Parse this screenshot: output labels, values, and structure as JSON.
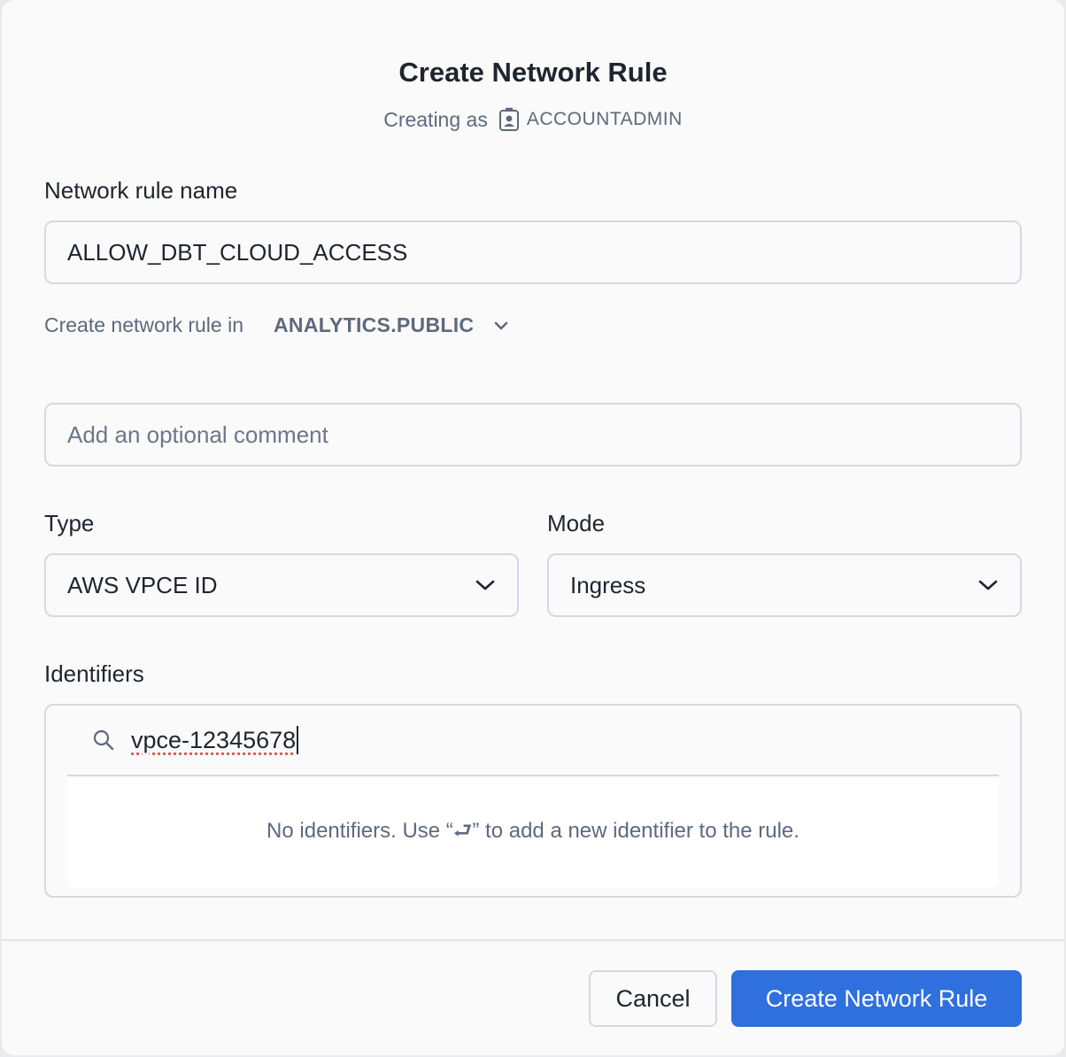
{
  "dialog": {
    "title": "Create Network Rule",
    "creating_as_label": "Creating as",
    "role": "ACCOUNTADMIN"
  },
  "name_field": {
    "label": "Network rule name",
    "value": "ALLOW_DBT_CLOUD_ACCESS"
  },
  "location": {
    "label": "Create network rule in",
    "schema": "ANALYTICS.PUBLIC"
  },
  "comment_field": {
    "placeholder": "Add an optional comment"
  },
  "type_field": {
    "label": "Type",
    "value": "AWS VPCE ID"
  },
  "mode_field": {
    "label": "Mode",
    "value": "Ingress"
  },
  "identifiers": {
    "label": "Identifiers",
    "input_value": "vpce-12345678",
    "empty_message": "No identifiers. Use “⮐” to add a new identifier to the rule."
  },
  "footer": {
    "cancel_label": "Cancel",
    "submit_label": "Create Network Rule"
  },
  "colors": {
    "primary": "#2f6fde",
    "border": "#d5d9e0",
    "text": "#1e252f",
    "muted": "#5d6a7d"
  },
  "icons": {
    "role": "user-badge-icon",
    "location_dropdown": "chevron-down-icon",
    "type_dropdown": "chevron-down-icon",
    "mode_dropdown": "chevron-down-icon",
    "search": "search-icon"
  }
}
